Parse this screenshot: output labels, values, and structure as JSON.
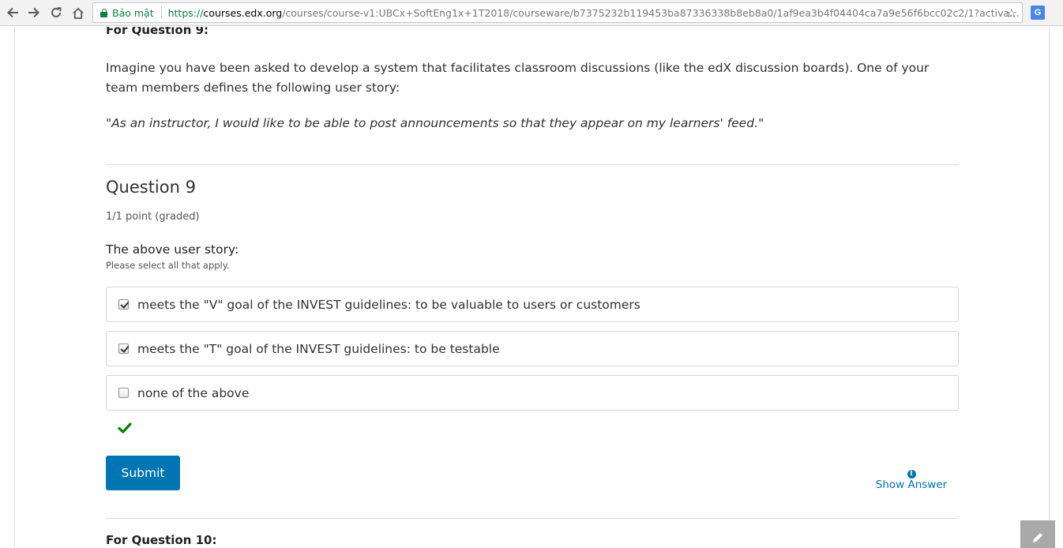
{
  "browser": {
    "secure_label": "Bảo mật",
    "url_scheme": "https://",
    "url_host": "courses.edx.org",
    "url_path": "/courses/course-v1:UBCx+SoftEng1x+1T2018/courseware/b7375232b119453ba87336338b8eb8a0/1af9ea3b4f04404ca7a9e56f6bcc02c2/1?activat..."
  },
  "section_header_top": "For Question 9:",
  "intro_text": "Imagine you have been asked to develop a system that facilitates classroom discussions (like the edX discussion boards). One of your team members defines the following user story:",
  "user_story": "\"As an instructor, I would like to be able to post announcements so that they appear on my learners' feed.\"",
  "question": {
    "title": "Question 9",
    "points": "1/1 point (graded)",
    "prompt": "The above user story:",
    "description": "Please select all that apply.",
    "choices": [
      {
        "label": "meets the \"V\" goal of the INVEST guidelines: to be valuable to users or customers",
        "checked": true
      },
      {
        "label": "meets the \"T\" goal of the INVEST guidelines: to be testable",
        "checked": true
      },
      {
        "label": "none of the above",
        "checked": false
      }
    ],
    "status": "correct",
    "submit_label": "Submit",
    "show_answer_label": "Show Answer"
  },
  "section_header_next": "For Question 10:",
  "colors": {
    "accent": "#0075b4",
    "correct": "#008100",
    "secure": "#0b8043"
  }
}
